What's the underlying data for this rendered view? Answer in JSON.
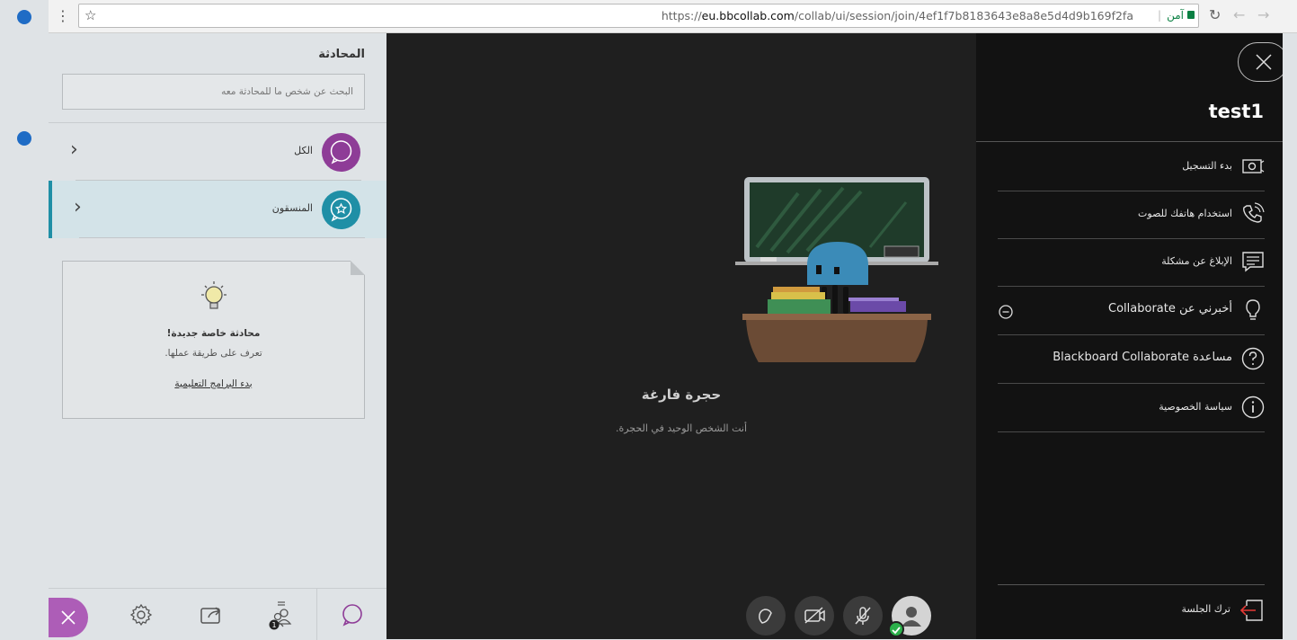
{
  "browser": {
    "url_prefix": "https://",
    "url_host": "eu.bbcollab.com",
    "url_path": "/collab/ui/session/join/4ef1f7b8183643e8a8e5d4d9b169f2fa",
    "secure_label": "آمن"
  },
  "chat": {
    "title": "المحادثة",
    "search_placeholder": "البحث عن شخص ما للمحادثة معه",
    "channels": [
      {
        "label": "الكل",
        "color": "#8e3c97"
      },
      {
        "label": "المنسقون",
        "color": "#1f8fa6"
      }
    ],
    "card": {
      "heading": "محادثة خاصة جديدة!",
      "body": "تعرف على طريقة عملها.",
      "link": "بدء البرامج التعليمية"
    },
    "participants_badge": "1"
  },
  "room": {
    "title": "حجرة فارغة",
    "subtitle": "أنت الشخص الوحيد في الحجرة."
  },
  "menu": {
    "user_name": "test1",
    "items": [
      {
        "label": "بدء التسجيل",
        "icon": "record-icon"
      },
      {
        "label": "استخدام هاتفك للصوت",
        "icon": "phone-icon"
      },
      {
        "label": "الإبلاغ عن مشكلة",
        "icon": "report-icon"
      },
      {
        "label": "أخبرني عن Collaborate",
        "icon": "lightbulb-icon"
      },
      {
        "label": "مساعدة Blackboard Collaborate",
        "icon": "help-icon"
      },
      {
        "label": "سياسة الخصوصية",
        "icon": "info-icon"
      }
    ],
    "leave_label": "ترك الجلسة"
  },
  "colors": {
    "accent_purple": "#ad5db7",
    "teal": "#1f8fa6",
    "room_bg": "#1f1f1f",
    "menu_bg": "#121212"
  }
}
